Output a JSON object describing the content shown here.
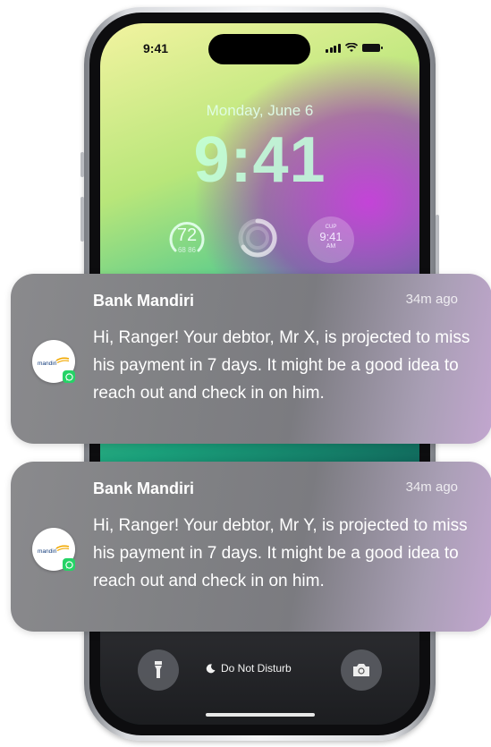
{
  "status_bar": {
    "time": "9:41"
  },
  "lock_screen": {
    "date": "Monday, June 6",
    "time": "9:41",
    "widgets": {
      "temperature": {
        "value": "72",
        "range": "68 86"
      },
      "clock": {
        "city": "CUP",
        "time": "9:41",
        "ampm": "AM"
      }
    },
    "do_not_disturb": "Do Not Disturb"
  },
  "notifications": [
    {
      "app": "Bank Mandiri",
      "time": "34m ago",
      "body": "Hi, Ranger! Your debtor, Mr X, is projected to miss his payment in 7 days. It might be a good idea to reach out and check in on him.",
      "icon": "mandiri-whatsapp-icon"
    },
    {
      "app": "Bank Mandiri",
      "time": "34m ago",
      "body": "Hi, Ranger! Your debtor, Mr Y, is projected to miss his payment in 7 days. It might be a good idea to reach out and check in on him.",
      "icon": "mandiri-whatsapp-icon"
    }
  ],
  "logo_text": "mandiri",
  "colors": {
    "notification_bg": "#808184",
    "accent_purple": "#c2a6cf",
    "whatsapp_green": "#25d366"
  }
}
